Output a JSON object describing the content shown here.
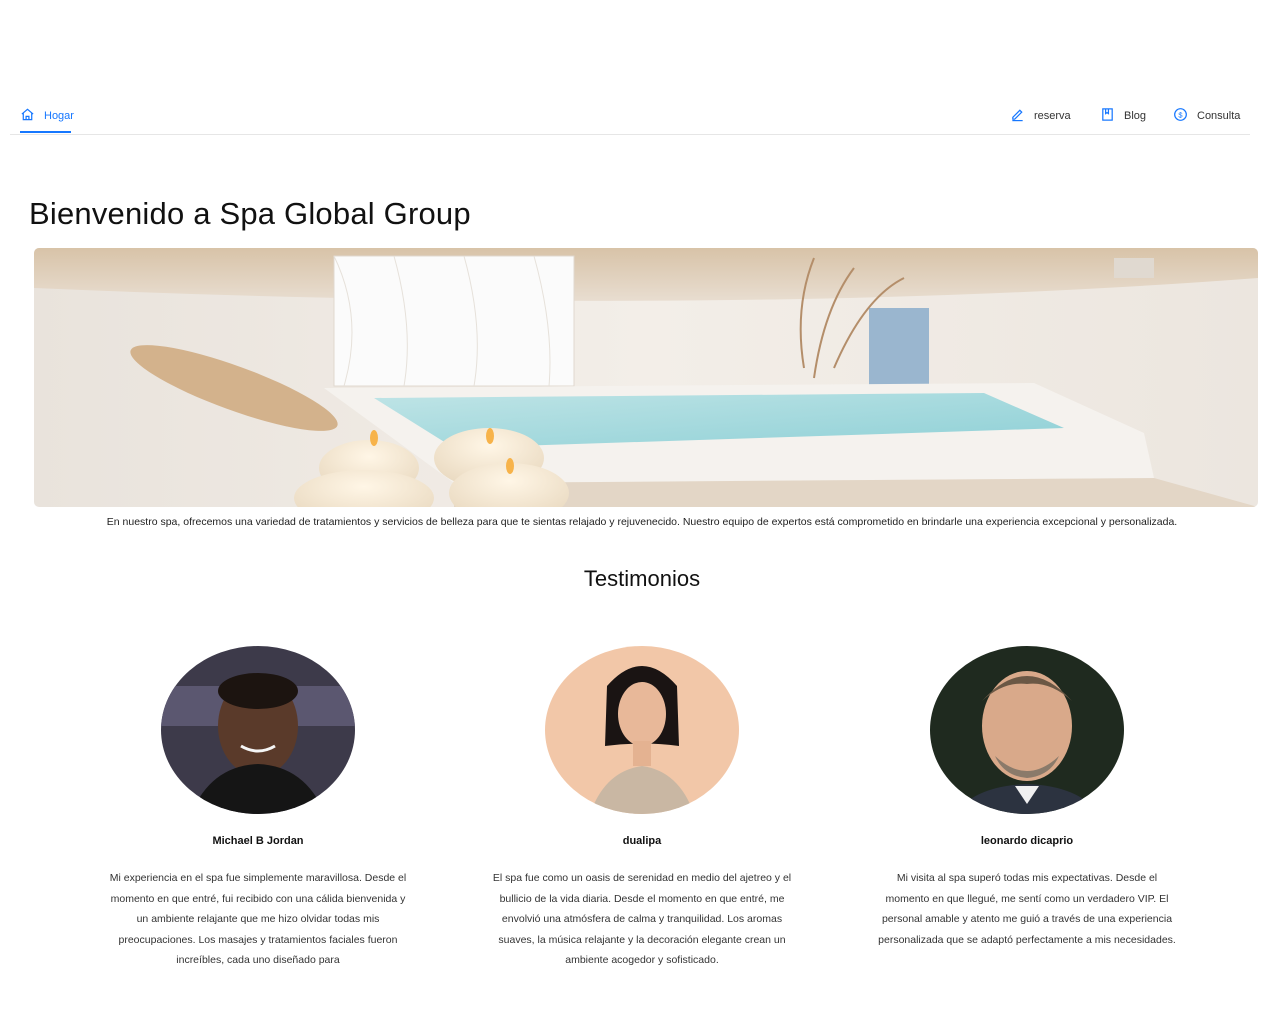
{
  "nav": {
    "home_label": "Hogar",
    "reserva_label": "reserva",
    "blog_label": "Blog",
    "consulta_label": "Consulta",
    "accent_color": "#1677ff"
  },
  "hero": {
    "title": "Bienvenido a Spa Global Group",
    "description": "En nuestro spa, ofrecemos una variedad de tratamientos y servicios de belleza para que te sientas relajado y rejuvenecido. Nuestro equipo de expertos está comprometido en brindarle una experiencia excepcional y personalizada."
  },
  "testimonials": {
    "title": "Testimonios",
    "items": [
      {
        "name": "Michael B Jordan",
        "quote": "Mi experiencia en el spa fue simplemente maravillosa. Desde el momento en que entré, fui recibido con una cálida bienvenida y un ambiente relajante que me hizo olvidar todas mis preocupaciones. Los masajes y tratamientos faciales fueron increíbles, cada uno diseñado para"
      },
      {
        "name": "dualipa",
        "quote": "El spa fue como un oasis de serenidad en medio del ajetreo y el bullicio de la vida diaria. Desde el momento en que entré, me envolvió una atmósfera de calma y tranquilidad. Los aromas suaves, la música relajante y la decoración elegante crean un ambiente acogedor y sofisticado."
      },
      {
        "name": "leonardo dicaprio",
        "quote": "Mi visita al spa superó todas mis expectativas. Desde el momento en que llegué, me sentí como un verdadero VIP. El personal amable y atento me guió a través de una experiencia personalizada que se adaptó perfectamente a mis necesidades."
      }
    ]
  }
}
